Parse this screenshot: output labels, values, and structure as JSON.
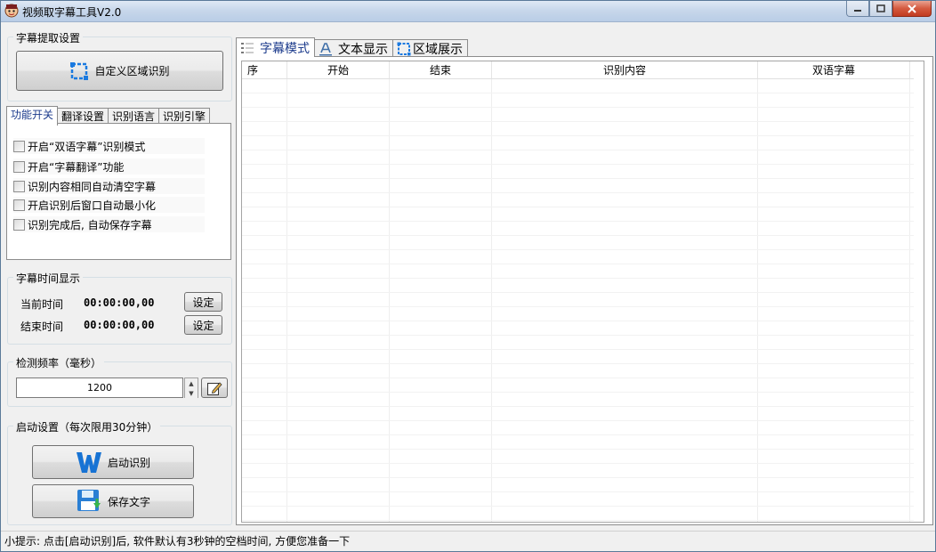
{
  "window": {
    "title": "视频取字幕工具V2.0"
  },
  "extract_settings": {
    "legend": "字幕提取设置",
    "custom_region_button": "自定义区域识别"
  },
  "left_tabs": [
    "功能开关",
    "翻译设置",
    "识别语言",
    "识别引擎"
  ],
  "function_switches": [
    {
      "label": "开启“双语字幕”识别模式",
      "checked": false
    },
    {
      "label": "开启“字幕翻译”功能",
      "checked": false
    },
    {
      "label": "识别内容相同自动清空字幕",
      "checked": false
    },
    {
      "label": "开启识别后窗口自动最小化",
      "checked": false
    },
    {
      "label": "识别完成后, 自动保存字幕",
      "checked": false
    }
  ],
  "time_display": {
    "legend": "字幕时间显示",
    "current_label": "当前时间",
    "current_value": "00:00:00,00",
    "end_label": "结束时间",
    "end_value": "00:00:00,00",
    "set_label": "设定"
  },
  "detect_freq": {
    "legend": "检测频率（毫秒）",
    "value": "1200"
  },
  "start_settings": {
    "legend": "启动设置（每次限用30分钟）",
    "start_button": "启动识别",
    "save_button": "保存文字"
  },
  "right_tabs": [
    "字幕模式",
    "文本显示",
    "区域展示"
  ],
  "table": {
    "columns": [
      "序",
      "开始",
      "结束",
      "识别内容",
      "双语字幕"
    ],
    "rows": []
  },
  "status": "小提示: 点击[启动识别]后, 软件默认有3秒钟的空档时间, 方便您准备一下",
  "colors": {
    "accent": "#1c3b8c",
    "title_gradient": "#c6d6ea",
    "close": "#c13b20"
  }
}
